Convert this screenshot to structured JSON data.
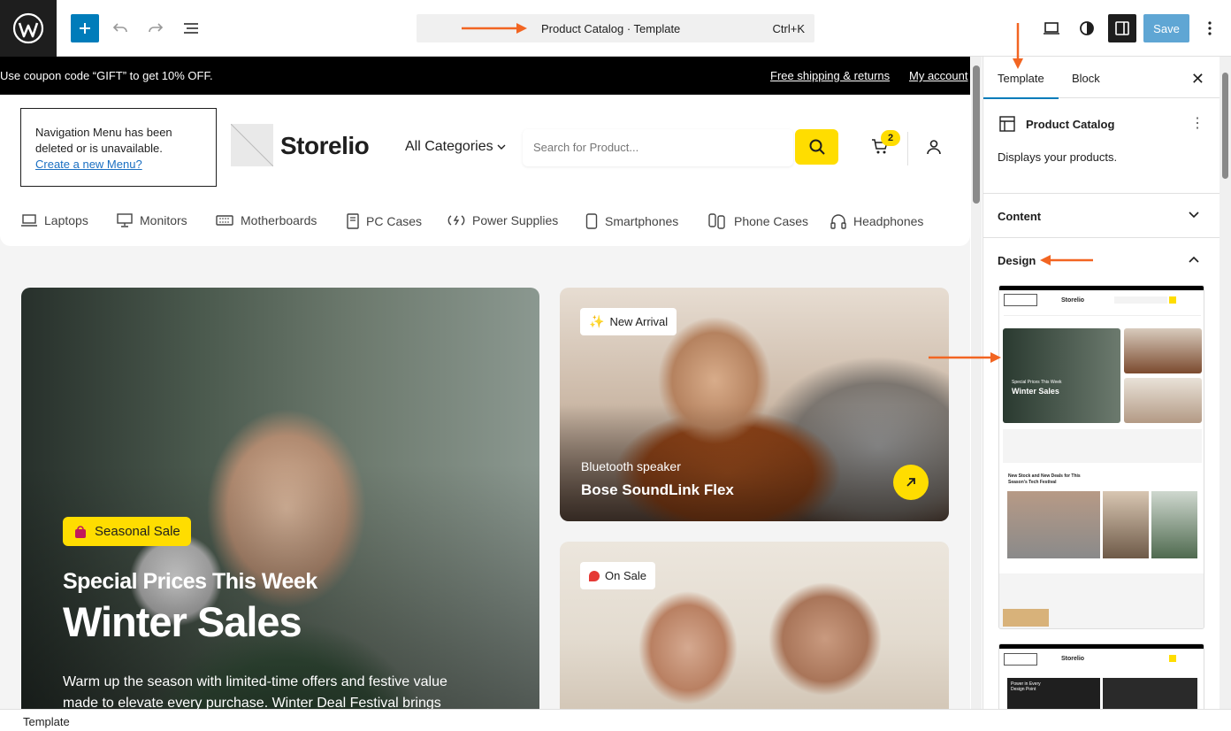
{
  "toolbar": {
    "command_title": "Product Catalog · Template",
    "shortcut": "Ctrl+K",
    "save_label": "Save"
  },
  "announcement": {
    "coupon": "Use coupon code “GIFT” to get 10% OFF.",
    "shipping_link": "Free shipping & returns",
    "account_link": "My account"
  },
  "header": {
    "nav_notice": "Navigation Menu has been deleted or is unavailable.",
    "nav_create_link": "Create a new Menu?",
    "brand": "Storelio",
    "all_categories": "All Categories",
    "search_placeholder": "Search for Product...",
    "cart_count": "2"
  },
  "categories": [
    {
      "label": "Laptops",
      "icon": "laptop-icon"
    },
    {
      "label": "Monitors",
      "icon": "monitor-icon"
    },
    {
      "label": "Motherboards",
      "icon": "motherboard-icon"
    },
    {
      "label": "PC Cases",
      "icon": "pc-case-icon"
    },
    {
      "label": "Power Supplies",
      "icon": "power-supply-icon"
    },
    {
      "label": "Smartphones",
      "icon": "smartphone-icon"
    },
    {
      "label": "Phone Cases",
      "icon": "phone-case-icon"
    },
    {
      "label": "Headphones",
      "icon": "headphones-icon"
    }
  ],
  "hero": {
    "badge": "Seasonal Sale",
    "subtitle": "Special Prices This Week",
    "title": "Winter Sales",
    "description": "Warm up the season with limited-time offers and festive value made to elevate every purchase. Winter Deal Festival brings"
  },
  "promo_cards": [
    {
      "badge": "New Arrival",
      "subtitle": "Bluetooth speaker",
      "title": "Bose SoundLink Flex"
    },
    {
      "badge": "On Sale"
    }
  ],
  "sidebar": {
    "tabs": [
      "Template",
      "Block"
    ],
    "block_name": "Product Catalog",
    "block_description": "Displays your products.",
    "panels": [
      "Content",
      "Design"
    ],
    "thumb_texts": {
      "brand": "Storelio",
      "special": "Special Prices This Week",
      "winter": "Winter Sales",
      "deals": "New Stock and New Deals for This Season's Tech Festival",
      "power": "Power in Every Design Point"
    }
  },
  "footer": {
    "breadcrumb": "Template"
  },
  "colors": {
    "accent_blue": "#007cba",
    "yellow": "#ffdd00",
    "annotation_orange": "#f26522"
  }
}
